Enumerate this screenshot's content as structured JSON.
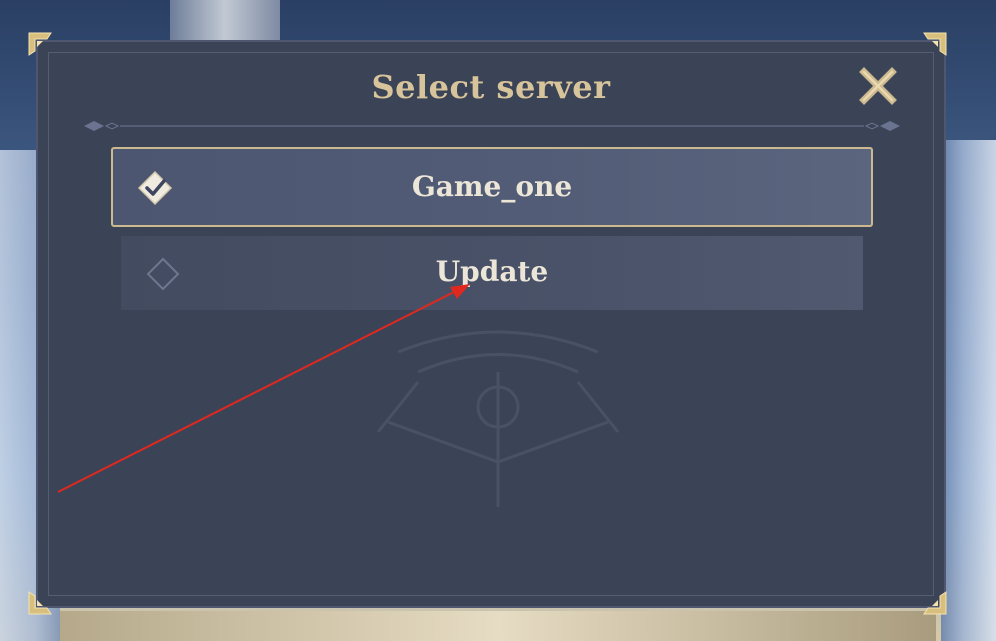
{
  "dialog": {
    "title": "Select server",
    "close_icon": "close-x-icon"
  },
  "servers": [
    {
      "label": "Game_one",
      "selected": true,
      "icon": "checked-diamond-icon"
    },
    {
      "label": "Update",
      "selected": false,
      "icon": "empty-diamond-icon"
    }
  ],
  "colors": {
    "dialog_bg": "#3b4357",
    "title": "#d8c49a",
    "gold_border": "#cdb98f",
    "server_text": "#ece6d8",
    "annotation_arrow": "#e0281f"
  },
  "annotation": {
    "icon": "red-arrow-pointer",
    "target": "Update"
  }
}
